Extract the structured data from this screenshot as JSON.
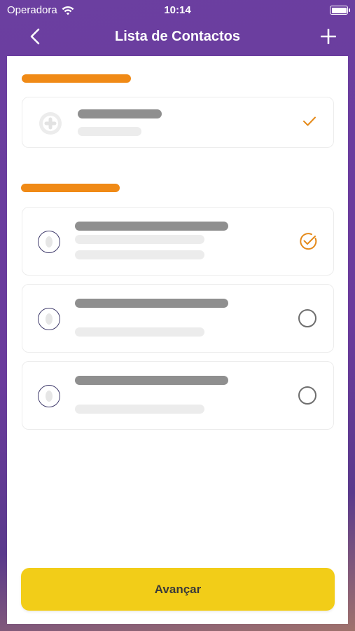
{
  "status_bar": {
    "carrier": "Operadora",
    "time": "10:14",
    "wifi_icon": "wifi-icon",
    "battery_icon": "battery-icon"
  },
  "nav": {
    "title": "Lista de Contactos",
    "back_icon": "chevron-left-icon",
    "add_icon": "plus-icon"
  },
  "colors": {
    "header_gradient": "#6b3fa0",
    "section_accent": "#f08a16",
    "check_accent": "#e58a1a",
    "cta_background": "#f2cd18",
    "skeleton_dark": "#8f8f8f",
    "skeleton_light": "#ececec"
  },
  "sections": [
    {
      "contacts": [
        {
          "state": "checked",
          "avatar_icon": "plus-circle-icon",
          "indicator_icon": "checkmark-icon"
        }
      ]
    },
    {
      "contacts": [
        {
          "state": "selected",
          "avatar_icon": "person-icon",
          "indicator_icon": "radio-checked-icon"
        },
        {
          "state": "unselected",
          "avatar_icon": "person-icon",
          "indicator_icon": "radio-empty-icon"
        },
        {
          "state": "unselected",
          "avatar_icon": "person-icon",
          "indicator_icon": "radio-empty-icon"
        }
      ]
    }
  ],
  "cta": {
    "label": "Avançar"
  }
}
